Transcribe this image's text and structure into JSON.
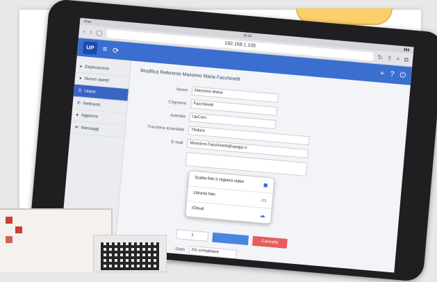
{
  "tablet": {
    "status_time": "18:34",
    "url": "192.168.1.105",
    "app_logo": "UP",
    "sidebar": {
      "items": [
        {
          "label": "Esplorazione",
          "icon": "folder-icon"
        },
        {
          "label": "Nuovo utente",
          "icon": "user-icon"
        },
        {
          "label": "Utenti",
          "icon": "users-icon"
        },
        {
          "label": "Referenti",
          "icon": "phone-icon"
        },
        {
          "label": "Aggiorna",
          "icon": "refresh-icon"
        },
        {
          "label": "Messaggi",
          "icon": "message-icon"
        }
      ]
    },
    "page_title": "Modifica Referente Massimo Maria Facchinetti",
    "form": {
      "fields": [
        {
          "label": "Nome",
          "value": "Massimo Maria",
          "wide": false
        },
        {
          "label": "Cognome",
          "value": "Facchinetti",
          "wide": false
        },
        {
          "label": "Azienda",
          "value": "UpCom",
          "wide": false
        },
        {
          "label": "Funzione aziendale",
          "value": "Titolare",
          "wide": true
        },
        {
          "label": "E-mail",
          "value": "Massimo.Facchinetti@upapp.it",
          "wide": true
        }
      ]
    },
    "popover": {
      "items": [
        {
          "label": "Scatta foto o registra video",
          "icon": "camera-icon"
        },
        {
          "label": "Libreria foto",
          "icon": "gallery-icon"
        },
        {
          "label": "iCloud",
          "icon": "cloud-icon"
        }
      ]
    },
    "bottom": {
      "stepper_value": "1",
      "cancel_label": "Cancella",
      "select_label": "Stato",
      "select_value": "Da completare"
    }
  }
}
